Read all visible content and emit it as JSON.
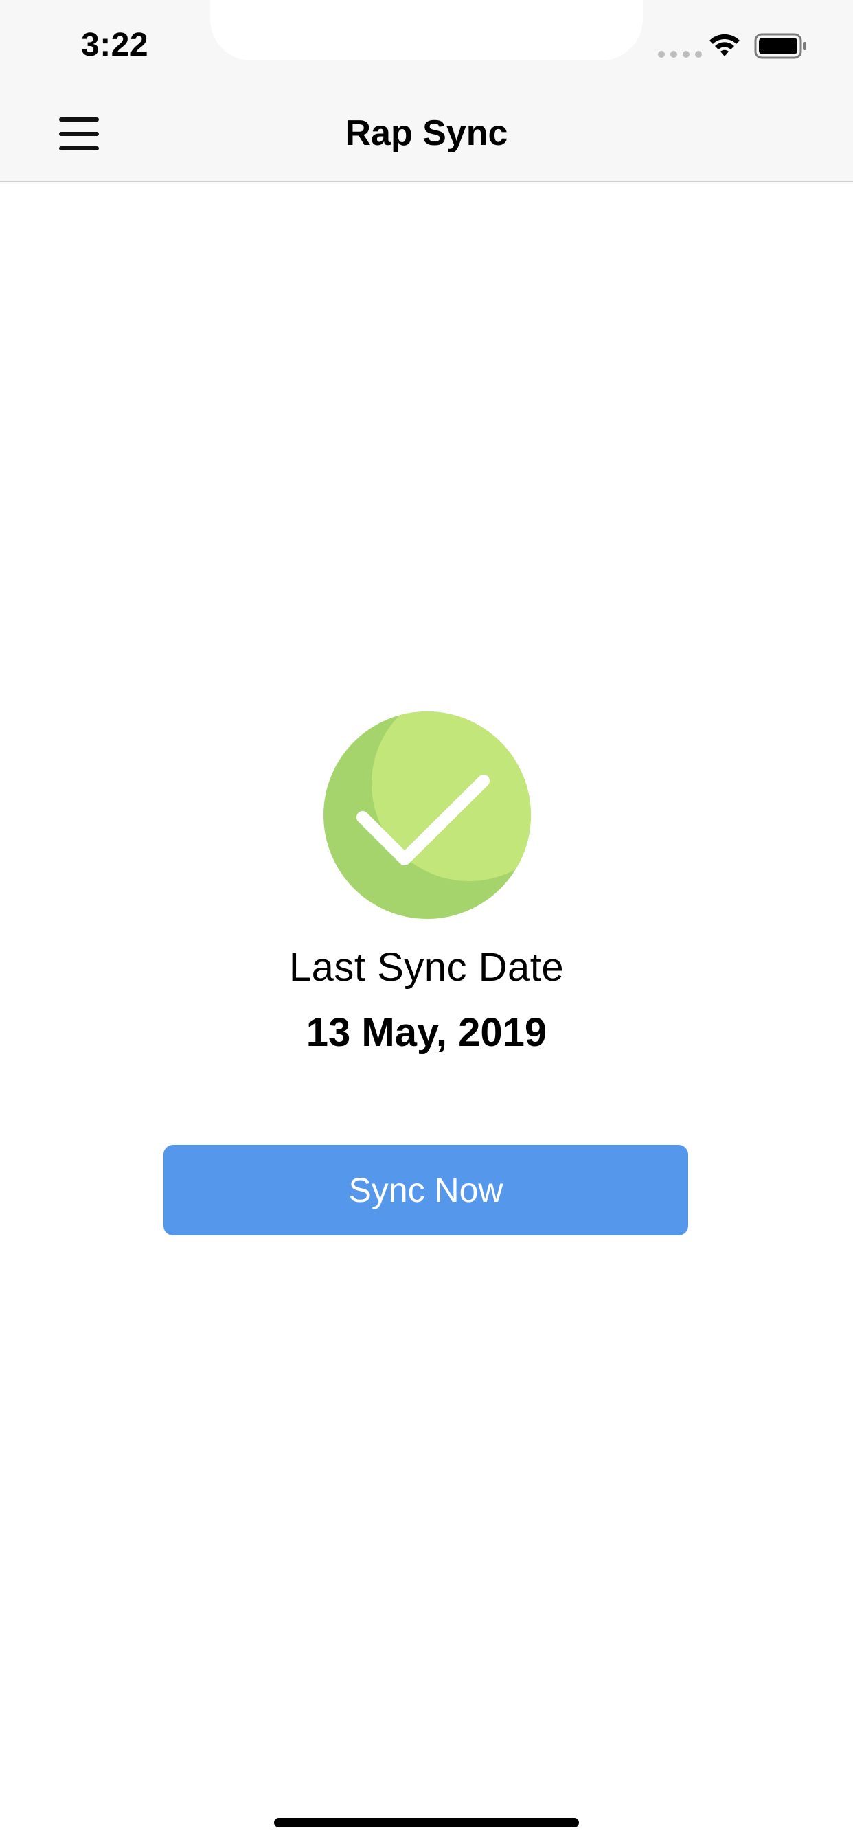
{
  "status_bar": {
    "time": "3:22",
    "icons": [
      "signal-dots-icon",
      "wifi-icon",
      "battery-icon"
    ]
  },
  "nav_bar": {
    "title": "Rap Sync",
    "menu_icon": "hamburger-menu-icon"
  },
  "sync_status": {
    "icon": "check-circle-icon",
    "label": "Last Sync Date",
    "date": "13 May, 2019"
  },
  "actions": {
    "sync_now_label": "Sync Now"
  },
  "colors": {
    "accent": "#5597eb",
    "check_light": "#c2e67a",
    "check_dark": "#a5d46d",
    "nav_background": "#f7f7f7"
  }
}
